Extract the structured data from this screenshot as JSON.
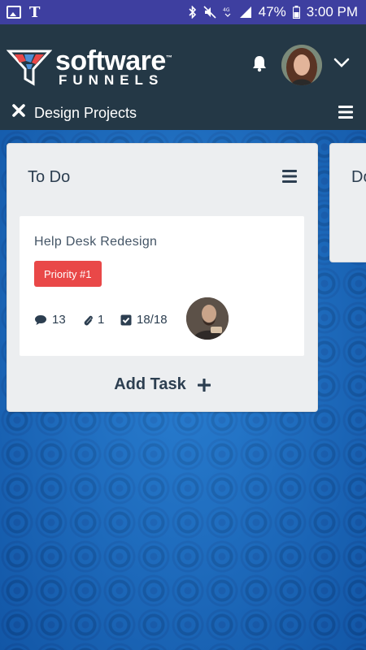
{
  "status_bar": {
    "battery": "47%",
    "time": "3:00 PM"
  },
  "header": {
    "logo_top": "software",
    "logo_tm": "™",
    "logo_bottom": "FUNNELS",
    "project_title": "Design Projects"
  },
  "columns": [
    {
      "title": "To Do",
      "cards": [
        {
          "title": "Help Desk Redesign",
          "badge": "Priority #1",
          "comments": "13",
          "attachments": "1",
          "checklist": "18/18"
        }
      ],
      "add_label": "Add Task"
    },
    {
      "title": "Do"
    }
  ],
  "colors": {
    "status_bar": "#3e3fa0",
    "header": "#243846",
    "badge": "#e94848",
    "board": "#1c6fc4"
  }
}
